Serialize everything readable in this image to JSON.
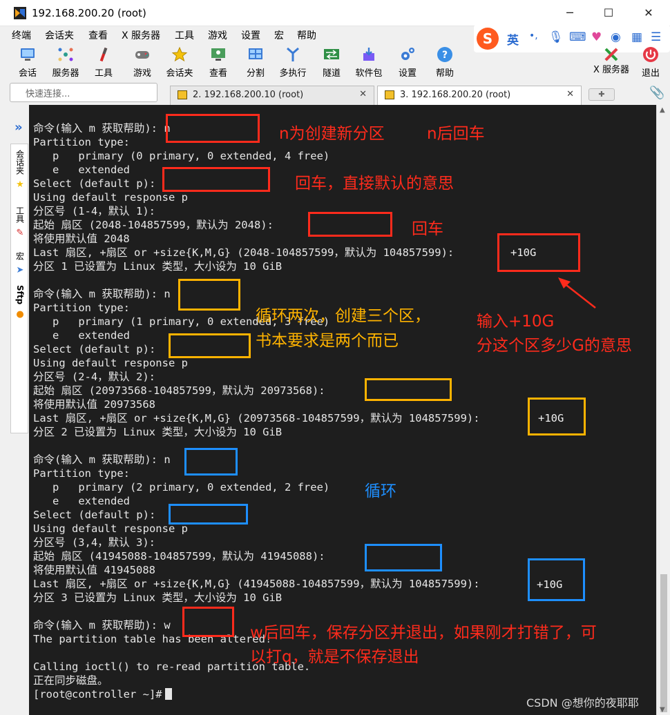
{
  "window": {
    "title": "192.168.200.20 (root)",
    "controls": {
      "minimize": "─",
      "maximize": "☐",
      "close": "✕"
    }
  },
  "menu": [
    "终端",
    "会话夹",
    "查看",
    "X 服务器",
    "工具",
    "游戏",
    "设置",
    "宏",
    "帮助"
  ],
  "ime": {
    "logo": "S",
    "lang": "英",
    "punct": "•,"
  },
  "toolbar": [
    {
      "label": "会话",
      "icon": "session-icon"
    },
    {
      "label": "服务器",
      "icon": "servers-icon"
    },
    {
      "label": "工具",
      "icon": "tools-icon"
    },
    {
      "label": "游戏",
      "icon": "games-icon"
    },
    {
      "label": "会话夹",
      "icon": "favorites-star-icon"
    },
    {
      "label": "查看",
      "icon": "view-icon"
    },
    {
      "label": "分割",
      "icon": "split-icon"
    },
    {
      "label": "多执行",
      "icon": "multiexec-icon"
    },
    {
      "label": "隧道",
      "icon": "tunnel-icon"
    },
    {
      "label": "软件包",
      "icon": "packages-icon"
    },
    {
      "label": "设置",
      "icon": "settings-icon"
    },
    {
      "label": "帮助",
      "icon": "help-icon"
    }
  ],
  "toolbar_right": {
    "xserver": "X 服务器",
    "exit": "退出"
  },
  "quick_connect": {
    "placeholder": "快速连接..."
  },
  "tabs": [
    {
      "label": "2. 192.168.200.10 (root)",
      "active": false
    },
    {
      "label": "3. 192.168.200.20 (root)",
      "active": true
    }
  ],
  "sidebar": [
    {
      "label": "会话夹",
      "icon": "star-icon"
    },
    {
      "label": "工具",
      "icon": "tools-icon"
    },
    {
      "label": "宏",
      "icon": "macro-icon"
    },
    {
      "label": "Sftp",
      "icon": "sftp-icon"
    }
  ],
  "terminal": {
    "lines": [
      "命令(输入 m 获取帮助): n",
      "Partition type:",
      "   p   primary (0 primary, 0 extended, 4 free)",
      "   e   extended",
      "Select (default p):",
      "Using default response p",
      "分区号 (1-4，默认 1):",
      "起始 扇区 (2048-104857599，默认为 2048):",
      "将使用默认值 2048",
      "Last 扇区, +扇区 or +size{K,M,G} (2048-104857599，默认为 104857599):",
      "分区 1 已设置为 Linux 类型，大小设为 10 GiB",
      "",
      "命令(输入 m 获取帮助): n",
      "Partition type:",
      "   p   primary (1 primary, 0 extended, 3 free)",
      "   e   extended",
      "Select (default p):",
      "Using default response p",
      "分区号 (2-4，默认 2):",
      "起始 扇区 (20973568-104857599，默认为 20973568):",
      "将使用默认值 20973568",
      "Last 扇区, +扇区 or +size{K,M,G} (20973568-104857599，默认为 104857599):",
      "分区 2 已设置为 Linux 类型，大小设为 10 GiB",
      "",
      "命令(输入 m 获取帮助): n",
      "Partition type:",
      "   p   primary (2 primary, 0 extended, 2 free)",
      "   e   extended",
      "Select (default p):",
      "Using default response p",
      "分区号 (3,4，默认 3):",
      "起始 扇区 (41945088-104857599，默认为 41945088):",
      "将使用默认值 41945088",
      "Last 扇区, +扇区 or +size{K,M,G} (41945088-104857599，默认为 104857599):",
      "分区 3 已设置为 Linux 类型，大小设为 10 GiB",
      "",
      "命令(输入 m 获取帮助): w",
      "The partition table has been altered!",
      "",
      "Calling ioctl() to re-read partition table.",
      "正在同步磁盘。",
      "[root@controller ~]#"
    ]
  },
  "annotations": {
    "n_new": "n为创建新分区",
    "n_enter": "n后回车",
    "enter_default": "回车，直接默认的意思",
    "enter": "回车",
    "size_input_line1": "输入+10G",
    "size_input_line2": "分这个区多少G的意思",
    "loop_line1": "循环两次，创建三个区，",
    "loop_line2": "书本要求是两个而已",
    "loop": "循环",
    "w_line1": "w后回车，保存分区并退出，如果刚才打错了，可",
    "w_line2": "以打q，就是不保存退出",
    "size_value": "+10G"
  },
  "watermark": "CSDN @想你的夜耶耶",
  "colors": {
    "red": "#ff2b1c",
    "yellow": "#ffb300",
    "blue": "#1e8fff",
    "terminal_bg": "#1e1e1e"
  }
}
